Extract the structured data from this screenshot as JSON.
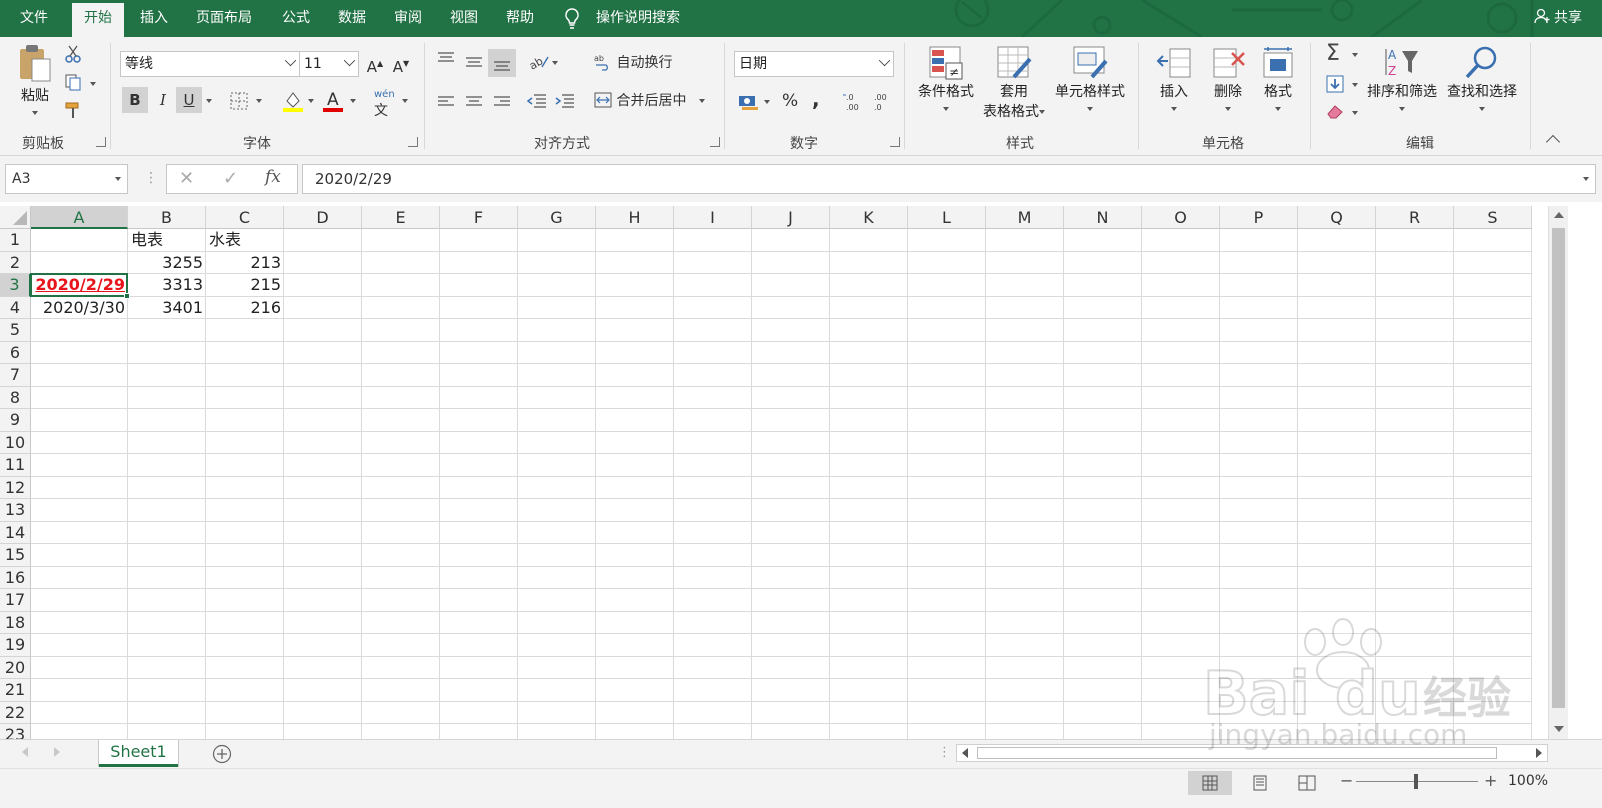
{
  "ribbon_tabs": [
    "文件",
    "开始",
    "插入",
    "页面布局",
    "公式",
    "数据",
    "审阅",
    "视图",
    "帮助"
  ],
  "active_tab": "开始",
  "tell_me": "操作说明搜索",
  "share": "共享",
  "clipboard": {
    "paste": "粘贴",
    "group": "剪贴板"
  },
  "font": {
    "name": "等线",
    "size": "11",
    "group": "字体",
    "bold": "B",
    "italic": "I",
    "underline": "U",
    "phonetic": "wén"
  },
  "alignment": {
    "wrap": "自动换行",
    "merge": "合并后居中",
    "group": "对齐方式"
  },
  "number": {
    "format": "日期",
    "percent": "%",
    "comma": ",",
    "group": "数字"
  },
  "styles": {
    "conditional": "条件格式",
    "table_line1": "套用",
    "table_line2": "表格格式",
    "cell_styles": "单元格样式",
    "group": "样式"
  },
  "cells": {
    "insert": "插入",
    "delete": "删除",
    "format": "格式",
    "group": "单元格"
  },
  "editing": {
    "sort": "排序和筛选",
    "find": "查找和选择",
    "group": "编辑"
  },
  "formula_bar": {
    "namebox": "A3",
    "fx": "fx",
    "value": "2020/2/29"
  },
  "columns": [
    "A",
    "B",
    "C",
    "D",
    "E",
    "F",
    "G",
    "H",
    "I",
    "J",
    "K",
    "L",
    "M",
    "N",
    "O",
    "P",
    "Q",
    "R",
    "S"
  ],
  "rows": [
    "1",
    "2",
    "3",
    "4",
    "5",
    "6",
    "7",
    "8",
    "9",
    "10",
    "11",
    "12",
    "13",
    "14",
    "15",
    "16",
    "17",
    "18",
    "19",
    "20",
    "21",
    "22",
    "23"
  ],
  "cells_data": {
    "B1": "电表",
    "C1": "水表",
    "B2": "3255",
    "C2": "213",
    "A3": "2020/2/29",
    "B3": "3313",
    "C3": "215",
    "A4": "2020/3/30",
    "B4": "3401",
    "C4": "216"
  },
  "selected_cell": "A3",
  "sheet_tabs": [
    "Sheet1"
  ],
  "zoom": "100%",
  "watermark": {
    "line1": "Baidu经验",
    "line2": "jingyan.baidu.com"
  },
  "colors": {
    "accent": "#217346",
    "selected_text": "#e8141c"
  }
}
